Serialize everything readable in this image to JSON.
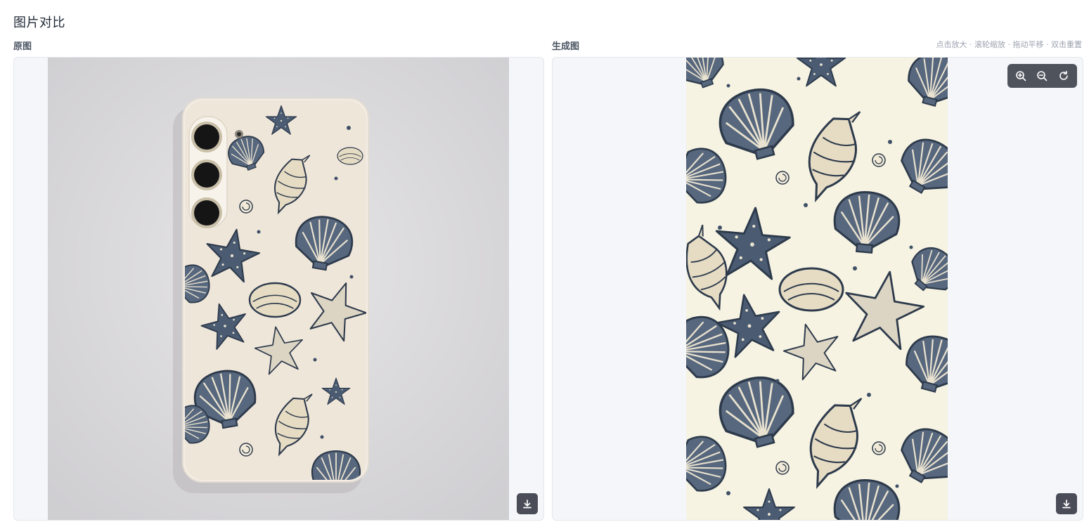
{
  "page": {
    "title": "图片对比"
  },
  "left_panel": {
    "label": "原图",
    "image_alt": "白色手机壳，印有贝壳与海星图案",
    "download_icon": "download-icon"
  },
  "right_panel": {
    "label": "生成图",
    "hint": "点击放大 · 滚轮缩放 · 拖动平移 · 双击重置",
    "image_alt": "贝壳与海星平铺图案",
    "zoom_controls": [
      {
        "icon": "zoom-in-icon"
      },
      {
        "icon": "zoom-out-icon"
      },
      {
        "icon": "reset-icon"
      }
    ],
    "download_icon": "download-icon"
  },
  "colors": {
    "pattern_blue": "#3f5066",
    "shell_cream": "#e9e0c8",
    "case_bg": "#efe6da",
    "generated_bg": "#f6f3e3",
    "backdrop": "#d9d8da"
  }
}
